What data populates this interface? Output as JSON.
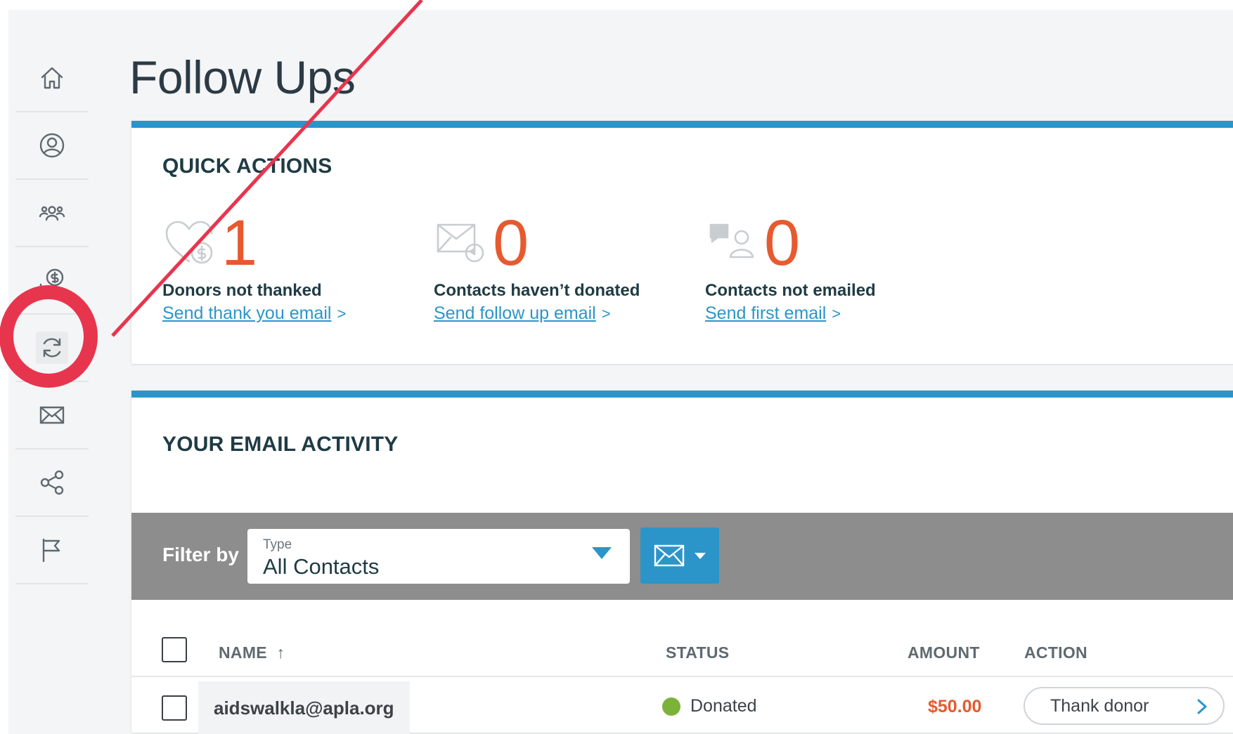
{
  "page": {
    "title": "Follow Ups"
  },
  "sidebar": {
    "items": [
      {
        "icon": "home-icon"
      },
      {
        "icon": "user-circle-icon"
      },
      {
        "icon": "group-icon"
      },
      {
        "icon": "donation-icon"
      },
      {
        "icon": "refresh-icon",
        "active": true
      },
      {
        "icon": "mail-icon"
      },
      {
        "icon": "share-icon"
      },
      {
        "icon": "flag-icon"
      }
    ]
  },
  "quick_actions": {
    "heading": "QUICK ACTIONS",
    "items": [
      {
        "icon": "heart-dollar-icon",
        "count": "1",
        "label": "Donors not thanked",
        "link": "Send thank you email",
        "chevron": ">"
      },
      {
        "icon": "mail-reply-icon",
        "count": "0",
        "label": "Contacts haven’t donated",
        "link": "Send follow up email",
        "chevron": ">"
      },
      {
        "icon": "chat-person-icon",
        "count": "0",
        "label": "Contacts not emailed",
        "link": "Send first email",
        "chevron": ">"
      }
    ]
  },
  "activity": {
    "heading": "YOUR EMAIL ACTIVITY",
    "filter": {
      "label": "Filter by",
      "type_label": "Type",
      "type_value": "All Contacts"
    },
    "columns": {
      "name": "NAME",
      "sort_indicator": "↑",
      "status": "STATUS",
      "amount": "AMOUNT",
      "action": "ACTION"
    },
    "rows": [
      {
        "email": "aidswalkla@apla.org",
        "status": "Donated",
        "status_color": "#7db23a",
        "amount": "$50.00",
        "action": "Thank donor"
      }
    ]
  },
  "colors": {
    "accent": "#2b95c9",
    "highlight_number": "#e65a2f",
    "annotation": "#e8354e"
  }
}
